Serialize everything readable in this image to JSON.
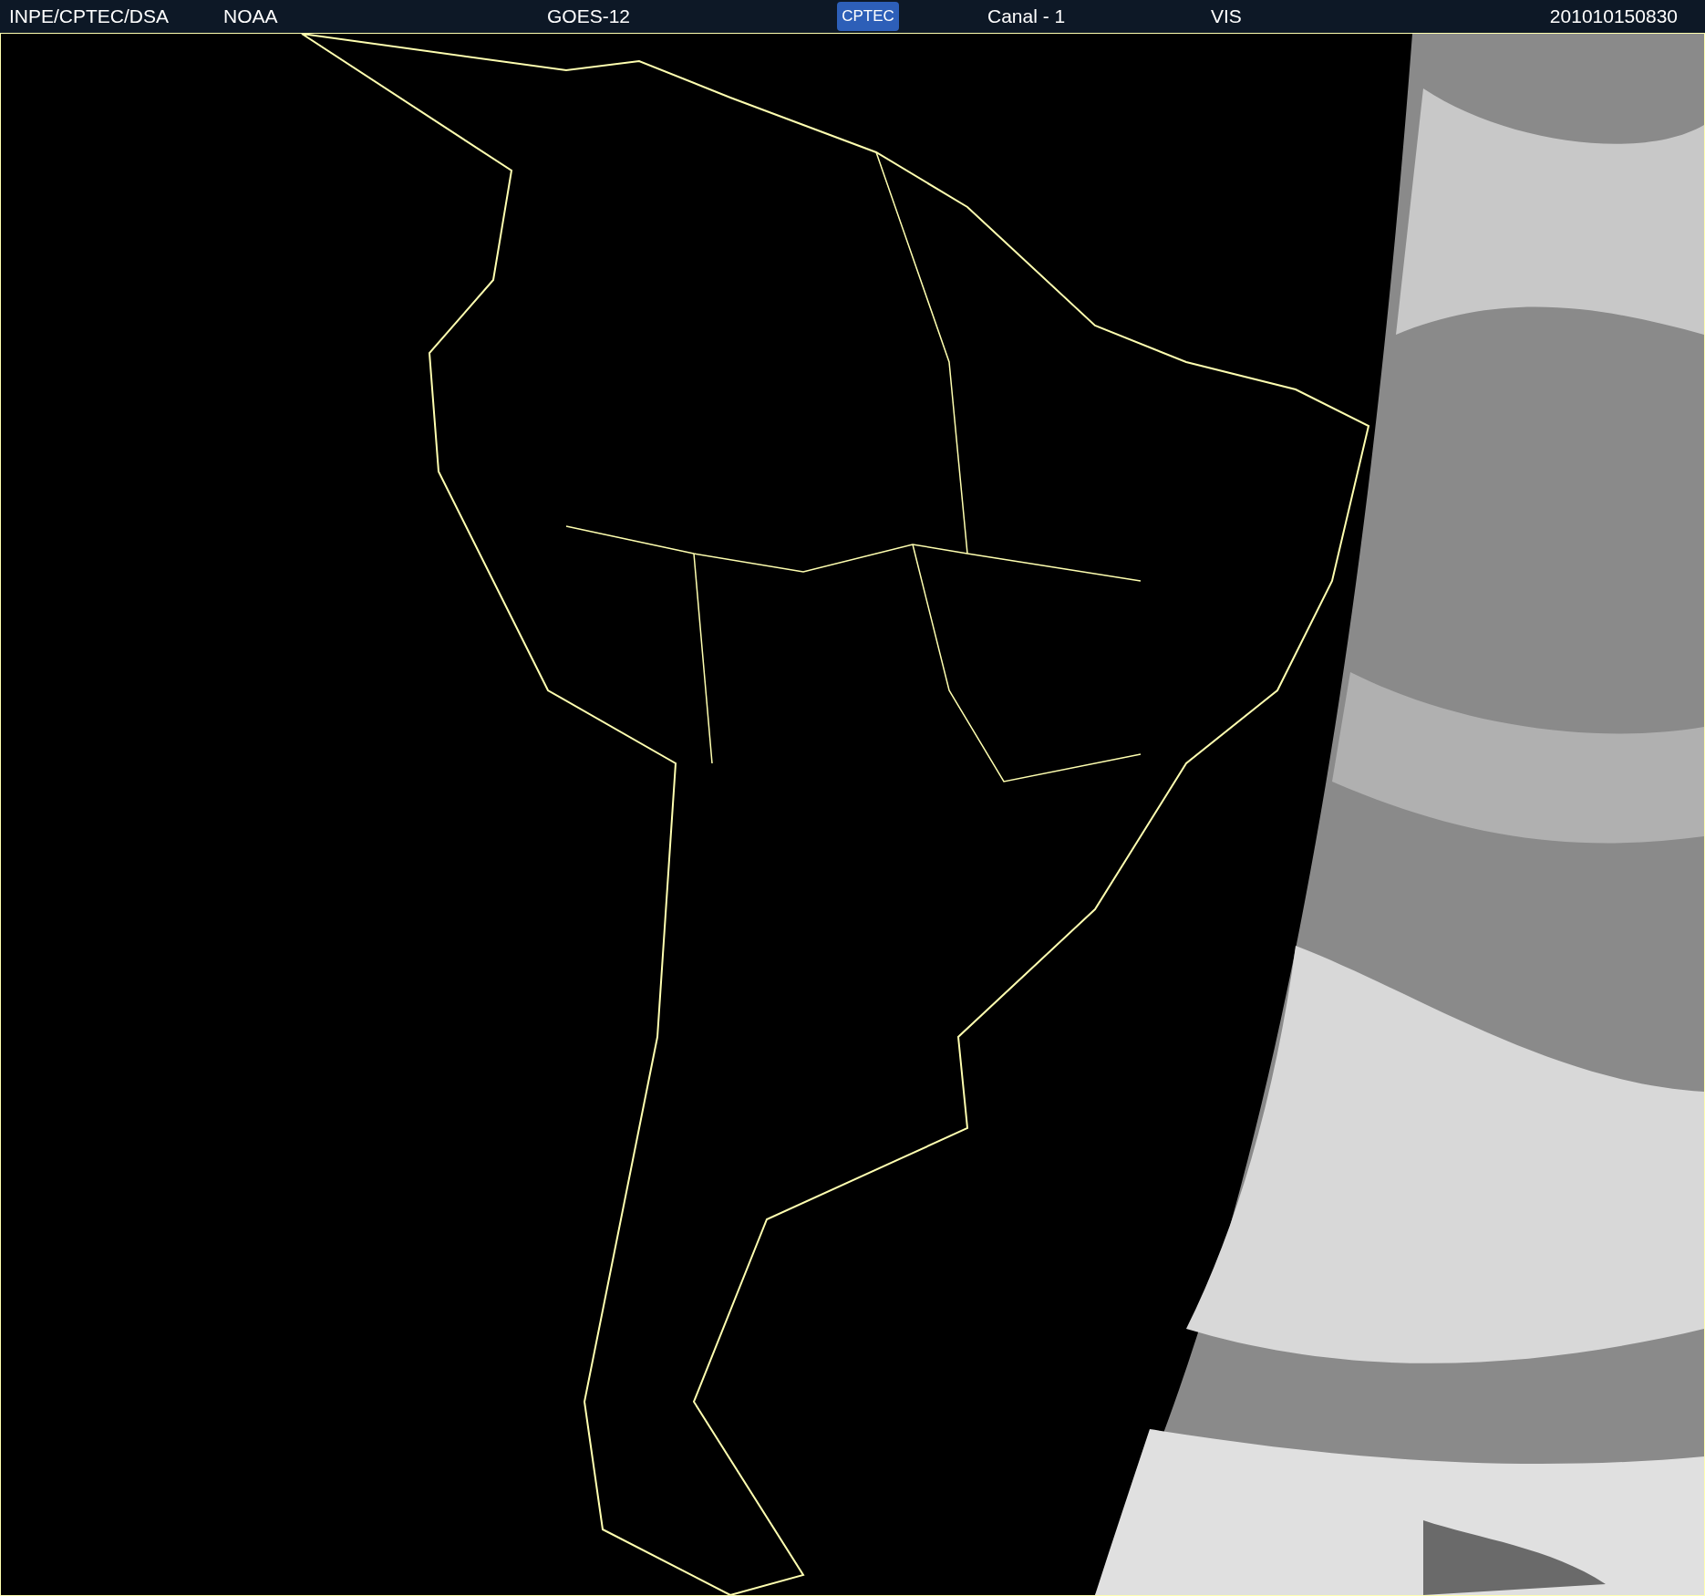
{
  "header": {
    "institution": "INPE/CPTEC/DSA",
    "agency": "NOAA",
    "satellite": "GOES-12",
    "logo": "CPTEC",
    "channel": "Canal - 1",
    "band": "VIS",
    "timestamp": "201010150830"
  }
}
